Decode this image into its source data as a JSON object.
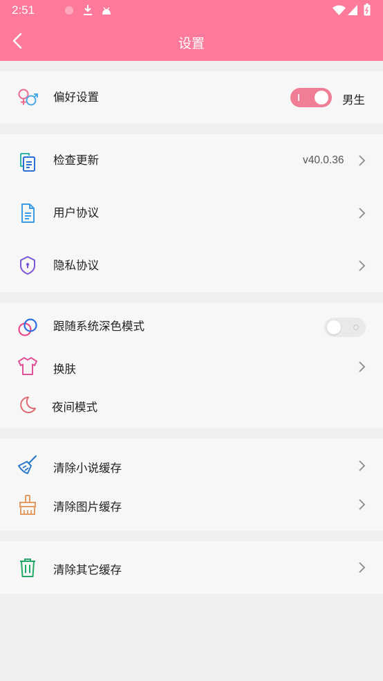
{
  "status_bar": {
    "time": "2:51",
    "icons": [
      "notification-dot-icon",
      "download-icon",
      "android-icon",
      "wifi-icon",
      "signal-icon",
      "battery-icon"
    ]
  },
  "header": {
    "title": "设置",
    "back_icon": "chevron-left-icon"
  },
  "colors": {
    "accent": "#fd7a9b",
    "toggle_on": "#f07f96",
    "toggle_off": "#e9e9e9",
    "background": "#efefef",
    "card": "#f7f7f7"
  },
  "preferences": {
    "label": "偏好设置",
    "icon": "gender-icon",
    "toggle_on": true,
    "value": "男生"
  },
  "about": {
    "update": {
      "label": "检查更新",
      "icon": "copy-document-icon",
      "value": "v40.0.36"
    },
    "user_agreement": {
      "label": "用户协议",
      "icon": "document-icon"
    },
    "privacy": {
      "label": "隐私协议",
      "icon": "shield-lock-icon"
    }
  },
  "appearance": {
    "dark_follow": {
      "label": "跟随系统深色模式",
      "icon": "rings-icon",
      "toggle_on": false
    },
    "skin": {
      "label": "换肤",
      "icon": "tshirt-icon"
    },
    "night": {
      "label": "夜间模式",
      "icon": "moon-icon"
    }
  },
  "cache": {
    "novel": {
      "label": "清除小说缓存",
      "icon": "broom-icon"
    },
    "image": {
      "label": "清除图片缓存",
      "icon": "brush-icon"
    },
    "other": {
      "label": "清除其它缓存",
      "icon": "trash-icon"
    }
  }
}
